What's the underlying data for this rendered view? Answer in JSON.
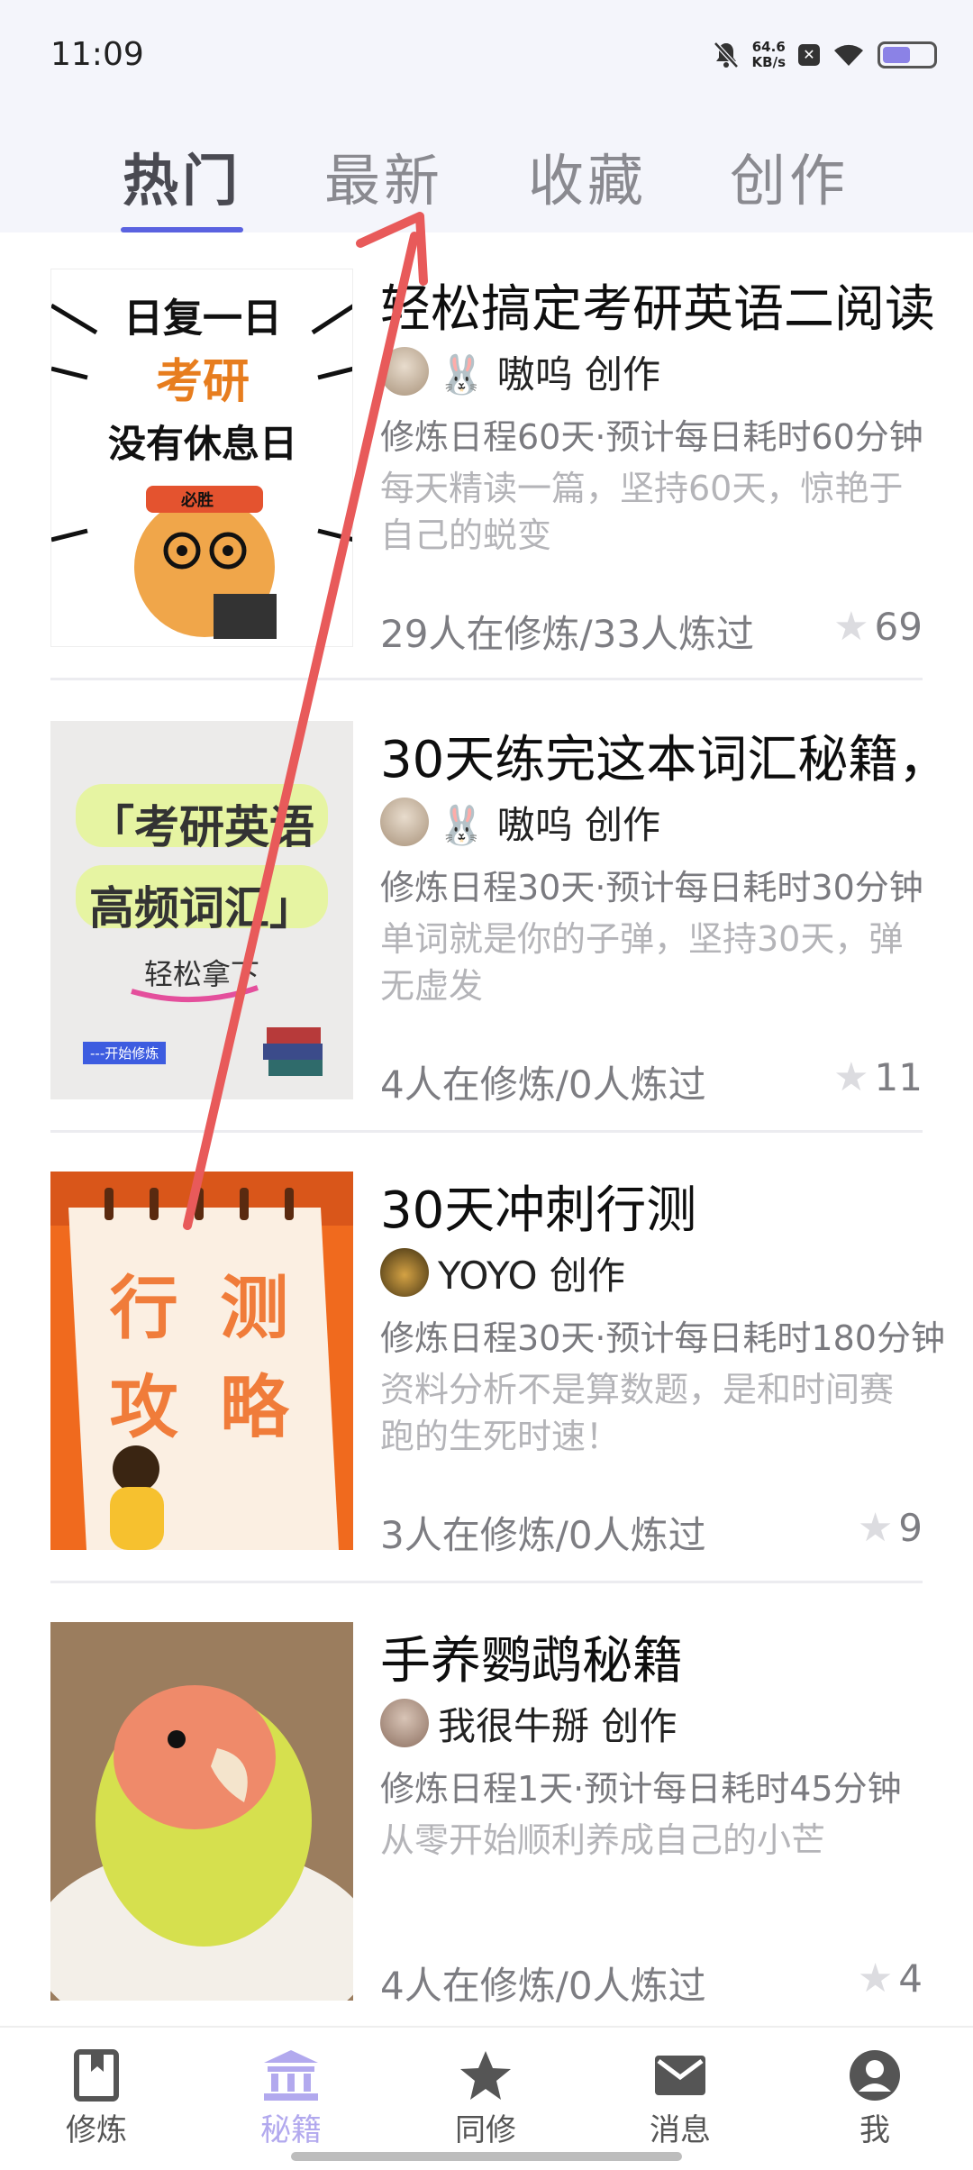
{
  "status_bar": {
    "time": "11:09",
    "net_speed_value": "64.6",
    "net_speed_unit": "KB/s",
    "battery_level": 0.55
  },
  "tabs": [
    {
      "label": "热门",
      "active": true
    },
    {
      "label": "最新",
      "active": false
    },
    {
      "label": "收藏",
      "active": false
    },
    {
      "label": "创作",
      "active": false
    }
  ],
  "cards": [
    {
      "title": "轻松搞定考研英语二阅读",
      "author": "🐰 嗷呜 创作",
      "meta": "修炼日程60天·预计每日耗时60分钟",
      "description": "每天精读一篇，坚持60天，惊艳于自己的蜕变",
      "stats": "29人在修炼/33人炼过",
      "rating": "69",
      "thumb": {
        "line1": "日复一日",
        "line2": "考研",
        "line3": "没有休息日",
        "badge": "必胜"
      }
    },
    {
      "title": "30天练完这本词汇秘籍，",
      "author": "🐰 嗷呜 创作",
      "meta": "修炼日程30天·预计每日耗时30分钟",
      "description": "单词就是你的子弹，坚持30天，弹无虚发",
      "stats": "4人在修炼/0人炼过",
      "rating": "11",
      "thumb": {
        "line1": "「考研英语",
        "line2": "高频词汇」",
        "line3": "轻松拿下",
        "badge": "---开始修炼"
      }
    },
    {
      "title": "30天冲刺行测",
      "author": "YOYO 创作",
      "meta": "修炼日程30天·预计每日耗时180分钟",
      "description": "资料分析不是算数题，是和时间赛跑的生死时速！",
      "stats": "3人在修炼/0人炼过",
      "rating": "9",
      "thumb": {
        "line1": "行 测",
        "line2": "攻 略"
      }
    },
    {
      "title": "手养鹦鹉秘籍",
      "author": "我很牛掰 创作",
      "meta": "修炼日程1天·预计每日耗时45分钟",
      "description": "从零开始顺利养成自己的小芒",
      "stats": "4人在修炼/0人炼过",
      "rating": "4"
    }
  ],
  "bottom_nav": [
    {
      "label": "修炼",
      "icon": "book-icon",
      "active": false
    },
    {
      "label": "秘籍",
      "icon": "library-icon",
      "active": true
    },
    {
      "label": "同修",
      "icon": "star-icon",
      "active": false
    },
    {
      "label": "消息",
      "icon": "mail-icon",
      "active": false
    },
    {
      "label": "我",
      "icon": "profile-icon",
      "active": false
    }
  ],
  "colors": {
    "accent": "#5a62e0",
    "nav_active": "#b2a9ee",
    "annotation_arrow": "#e85a5a"
  }
}
